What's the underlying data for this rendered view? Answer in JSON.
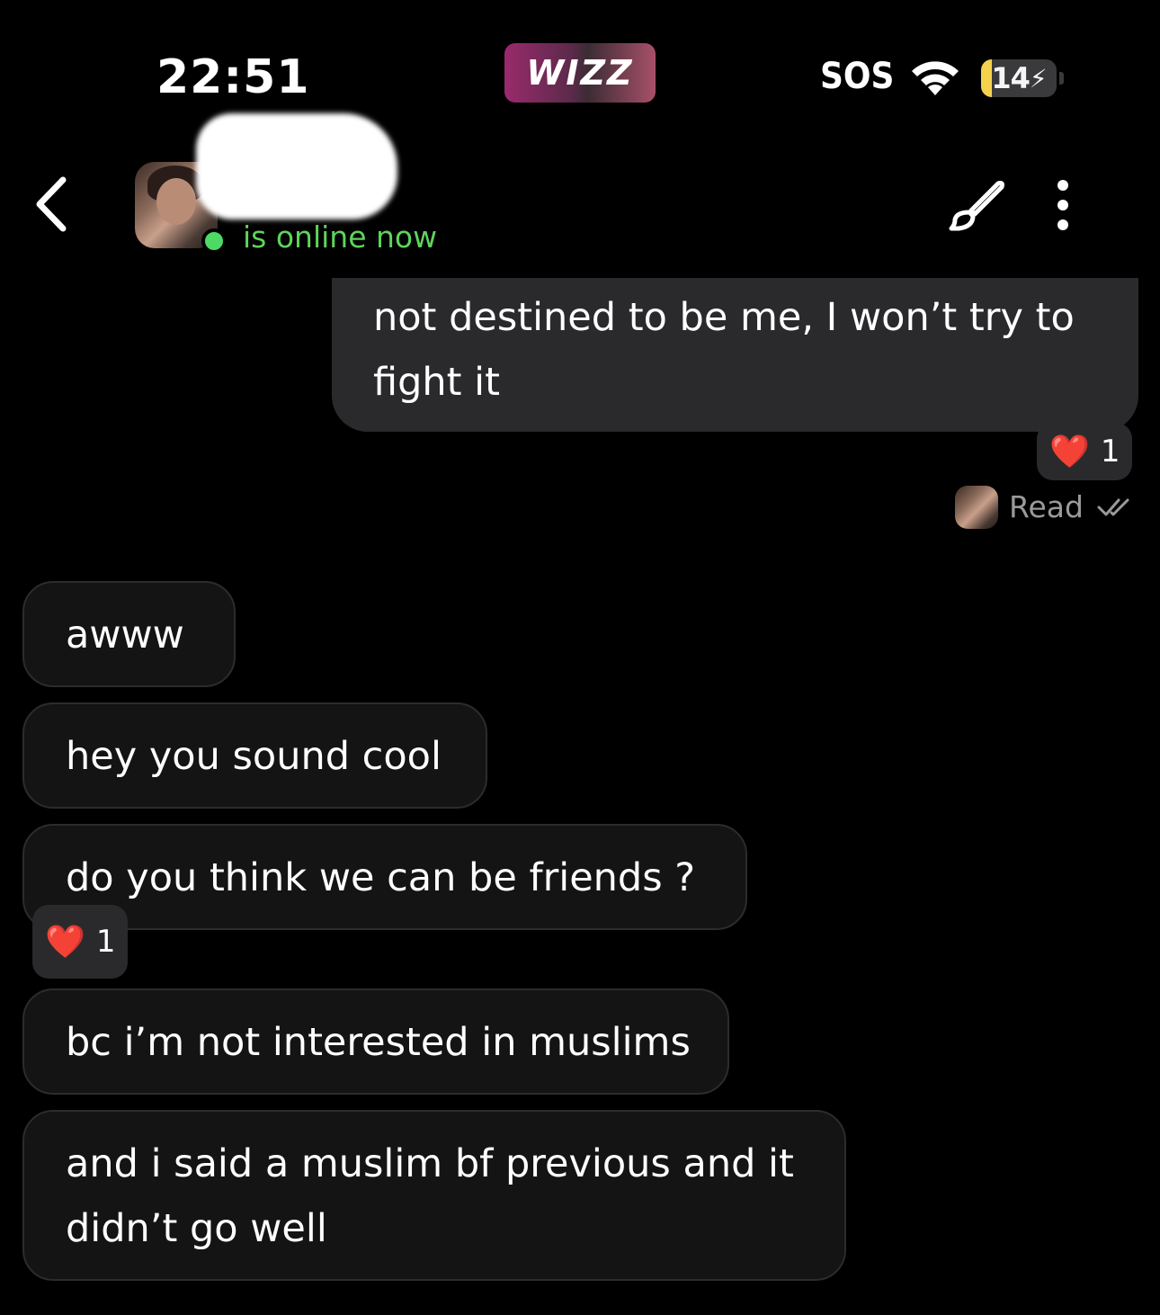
{
  "status_bar": {
    "time": "22:51",
    "app_badge": "WIZZ",
    "carrier": "SOS",
    "battery_level": "14",
    "battery_fraction": 0.14,
    "battery_color": "#f4d24e"
  },
  "header": {
    "contact_status": "is online now",
    "status_color": "#5fd35b"
  },
  "messages": [
    {
      "direction": "outgoing",
      "text": "not destined to be me, I won’t try to fight it",
      "reaction": {
        "emoji": "❤️",
        "count": "1"
      }
    },
    {
      "direction": "incoming",
      "text": "awww"
    },
    {
      "direction": "incoming",
      "text": "hey you sound cool"
    },
    {
      "direction": "incoming",
      "text": "do you think we can be friends ?",
      "reaction": {
        "emoji": "❤️",
        "count": "1"
      }
    },
    {
      "direction": "incoming",
      "text": "bc i’m not interested in muslims"
    },
    {
      "direction": "incoming",
      "text": "and i said a muslim bf previous and it didn’t go well"
    }
  ],
  "read_receipt": {
    "label": "Read"
  },
  "icons": {
    "back": "chevron-left-icon",
    "brush": "paint-brush-icon",
    "menu": "vertical-dots-icon",
    "wifi": "wifi-icon",
    "read": "double-check-icon"
  }
}
